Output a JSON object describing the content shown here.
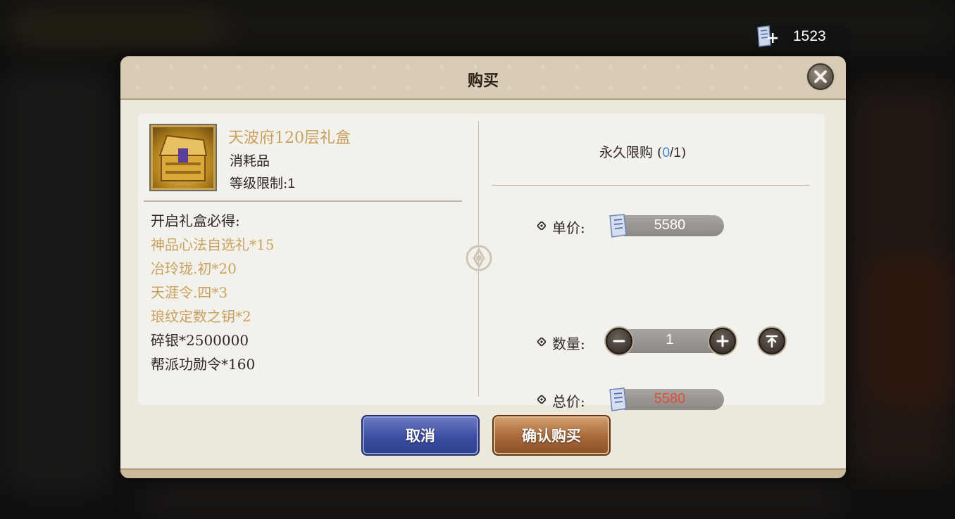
{
  "currency": {
    "amount": "1523",
    "plus": "+"
  },
  "dialog": {
    "title": "购买",
    "item": {
      "name": "天波府120层礼盒",
      "type": "消耗品",
      "level_label": "等级限制:",
      "level_value": "1"
    },
    "rewards": {
      "header": "开启礼盒必得:",
      "items": [
        {
          "text": "神品心法自选礼*15",
          "color": "gold"
        },
        {
          "text": "冶玲珑.初*20",
          "color": "gold"
        },
        {
          "text": "天涯令.四*3",
          "color": "gold"
        },
        {
          "text": "琅纹定数之钥*2",
          "color": "gold"
        },
        {
          "text": "碎银*2500000",
          "color": "dark"
        },
        {
          "text": "帮派功勋令*160",
          "color": "dark"
        }
      ]
    },
    "limit": {
      "label": "永久限购 (",
      "current": "0",
      "sep": "/",
      "max": "1",
      "close": ")"
    },
    "unit_price": {
      "label": "单价:",
      "value": "5580"
    },
    "quantity": {
      "label": "数量:",
      "value": "1"
    },
    "total_price": {
      "label": "总价:",
      "value": "5580"
    },
    "buttons": {
      "cancel": "取消",
      "confirm": "确认购买"
    }
  },
  "colors": {
    "gold_text": "#c8a15f",
    "dark_text": "#2b2722",
    "limit_blue": "#3b86d8",
    "total_red": "#e14b3c"
  },
  "icons": [
    "ticket-icon",
    "plus-icon",
    "close-icon",
    "gift-chest-icon",
    "diamond-bullet-icon",
    "minus-icon",
    "max-icon",
    "emblem-icon"
  ]
}
